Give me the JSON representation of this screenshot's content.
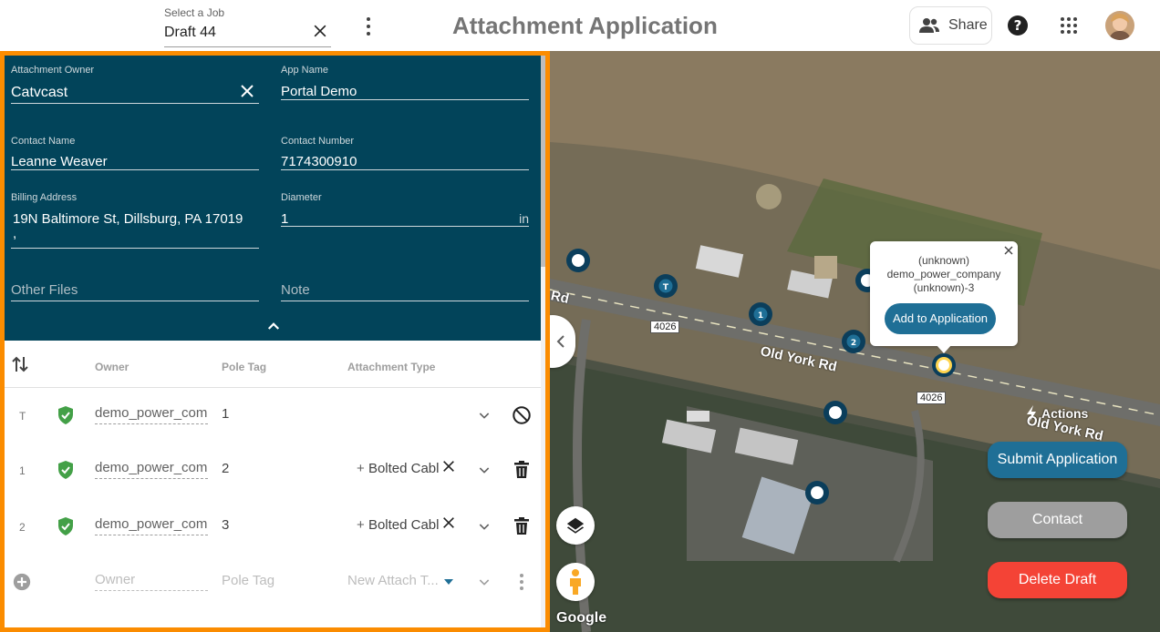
{
  "header": {
    "job_label": "Select a Job",
    "job_value": "Draft 44",
    "title": "Attachment Application",
    "share_label": "Share"
  },
  "form": {
    "owner_label": "Attachment Owner",
    "owner_value": "Catvcast",
    "app_name_label": "App Name",
    "app_name_value": "Portal Demo",
    "contact_name_label": "Contact Name",
    "contact_name_value": "Leanne Weaver",
    "contact_number_label": "Contact Number",
    "contact_number_value": "7174300910",
    "billing_label": "Billing Address",
    "billing_line1": "19N Baltimore St, Dillsburg, PA 17019",
    "billing_line2": ",",
    "diameter_label": "Diameter",
    "diameter_value": "1",
    "diameter_unit": "in",
    "other_files_placeholder": "Other Files",
    "note_placeholder": "Note"
  },
  "table": {
    "headers": {
      "owner": "Owner",
      "pole_tag": "Pole Tag",
      "attachment_type": "Attachment Type"
    },
    "rows": [
      {
        "index": "T",
        "owner": "demo_power_company",
        "pole_tag": "1",
        "attachment": ""
      },
      {
        "index": "1",
        "owner": "demo_power_company",
        "pole_tag": "2",
        "attachment": "Bolted Cable"
      },
      {
        "index": "2",
        "owner": "demo_power_company",
        "pole_tag": "3",
        "attachment": "Bolted Cable"
      }
    ],
    "new_row": {
      "owner_placeholder": "Owner",
      "pole_tag_placeholder": "Pole Tag",
      "attach_placeholder": "New Attach T..."
    }
  },
  "map": {
    "road_name": "Old York Rd",
    "road_name_2": "Old York Rd",
    "road_fragment": "Rd",
    "route_number": "4026",
    "route_number_2": "4026",
    "google_label": "Google",
    "markers": [
      "T",
      "1",
      "2"
    ],
    "popup": {
      "line1": "(unknown)",
      "line2": "demo_power_company",
      "line3": "(unknown)-3",
      "button": "Add to Application"
    },
    "actions_label": "Actions",
    "submit_label": "Submit Application",
    "contact_label": "Contact",
    "delete_label": "Delete Draft"
  },
  "colors": {
    "form_bg": "#02445a",
    "panel_border": "#fb8c00",
    "check_green": "#43a047",
    "submit_blue": "#1f6f96",
    "contact_gray": "#9e9e9e",
    "delete_red": "#f44336"
  }
}
